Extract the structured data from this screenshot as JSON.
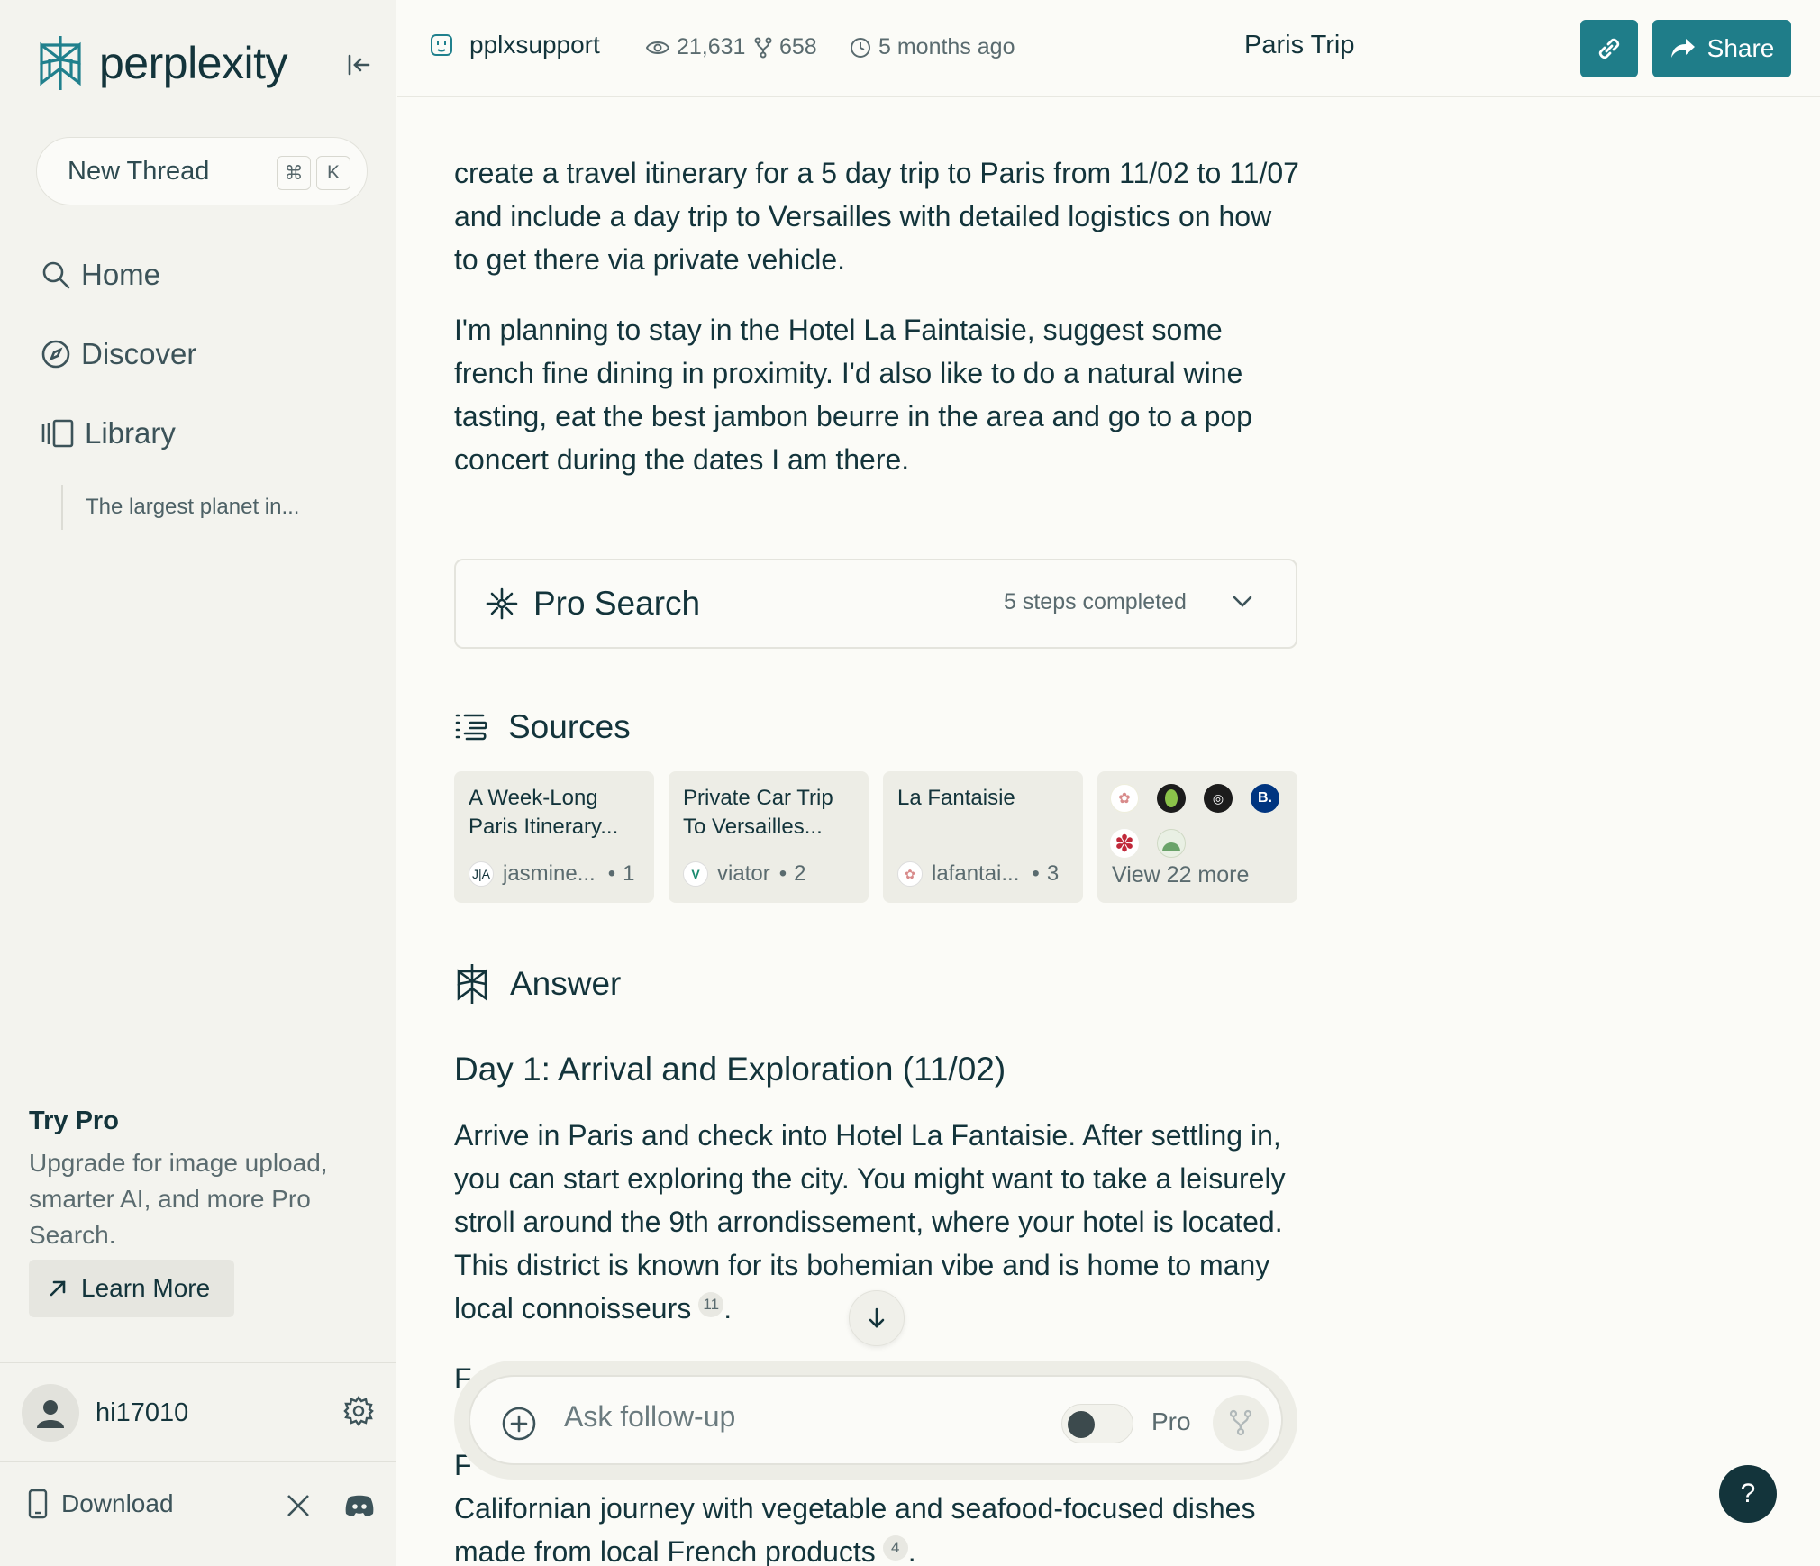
{
  "sidebar": {
    "logo_text": "perplexity",
    "new_thread_label": "New Thread",
    "shortcut_keys": [
      "⌘",
      "K"
    ],
    "nav": [
      {
        "label": "Home",
        "icon": "search-icon"
      },
      {
        "label": "Discover",
        "icon": "compass-icon"
      },
      {
        "label": "Library",
        "icon": "library-icon"
      }
    ],
    "library_items": [
      "The largest planet in..."
    ],
    "try_pro": {
      "title": "Try Pro",
      "description": "Upgrade for image upload, smarter AI, and more Pro Search.",
      "cta": "Learn More"
    },
    "user": {
      "name": "hi17010"
    },
    "download_label": "Download"
  },
  "header": {
    "author": "pplxsupport",
    "views": "21,631",
    "forks": "658",
    "time": "5 months ago",
    "title": "Paris Trip",
    "share_label": "Share"
  },
  "thread": {
    "query_p1": "create a travel itinerary for a 5 day trip to Paris from 11/02 to 11/07 and include a day trip to Versailles with detailed logistics on how to get there via private vehicle.",
    "query_p2": "I'm planning to stay in the Hotel La Faintaisie, suggest some french fine dining in proximity. I'd also like to do a natural wine tasting, eat the best jambon beurre in the area and go to a pop concert during the dates I am there.",
    "pro_search": {
      "label": "Pro Search",
      "steps": "5 steps completed"
    },
    "sources_label": "Sources",
    "sources": [
      {
        "title": "A Week-Long Paris Itinerary...",
        "site": "jasmine...",
        "index": "1",
        "favicon": "J|A"
      },
      {
        "title": "Private Car Trip To Versailles...",
        "site": "viator",
        "index": "2",
        "favicon": "V"
      },
      {
        "title": "La Fantaisie",
        "site": "lafantai...",
        "index": "3",
        "favicon": "✿"
      }
    ],
    "view_more": "View 22 more",
    "more_badge": "B.",
    "answer_label": "Answer",
    "day1_title": "Day 1: Arrival and Exploration (11/02)",
    "day1_text": "Arrive in Paris and check into Hotel La Fantaisie. After settling in, you can start exploring the city. You might want to take a leisurely stroll around the 9th arrondissement, where your hotel is located. This district is known for its bohemian vibe and is home to many local connoisseurs",
    "day1_cite": "11",
    "partial_line_1": "F",
    "partial_line_2": "F",
    "tail_text": "Californian journey with vegetable and seafood-focused dishes made from local French products",
    "tail_cite": "4"
  },
  "followup": {
    "placeholder": "Ask follow-up",
    "pro_label": "Pro"
  },
  "help_label": "?",
  "colors": {
    "accent": "#1f7d89",
    "text": "#13343b",
    "sidebar_bg": "#f3f3ee",
    "main_bg": "#fbfbf7"
  }
}
